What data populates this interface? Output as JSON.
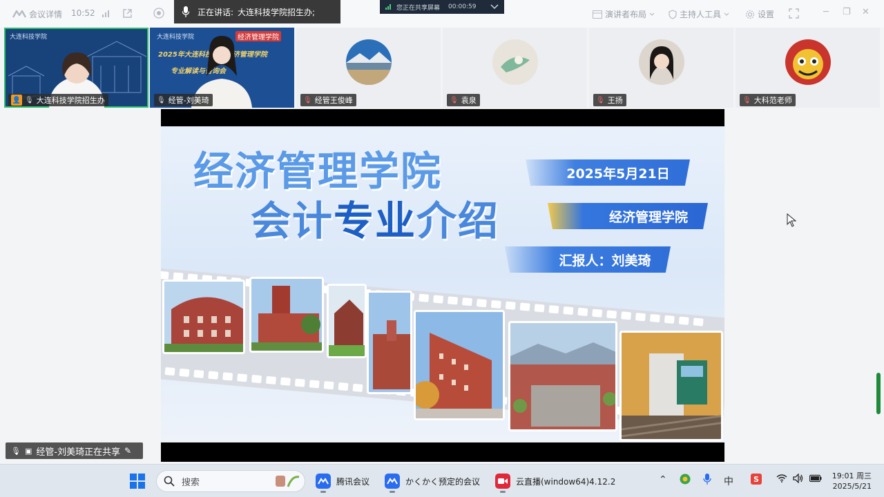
{
  "topbar": {
    "meeting_info_label": "会议详情",
    "time": "10:52",
    "speaking_label": "正在讲话:",
    "speaking_name": "大连科技学院招生办;",
    "share_status": "您正在共享屏幕",
    "share_timer": "00:00:59",
    "presenter_layout_label": "演讲者布局",
    "host_tools_label": "主持人工具",
    "settings_label": "设置"
  },
  "participants": [
    {
      "name": "大连科技学院招生办",
      "role": "host"
    },
    {
      "name": "经管-刘美琦"
    },
    {
      "name": "经管王俊峰"
    },
    {
      "name": "袁泉"
    },
    {
      "name": "王扬"
    },
    {
      "name": "大科范老师"
    }
  ],
  "tile_texts": {
    "college_logo_1": "大连科技学院",
    "college_logo_2": "大连科技学院",
    "dept_logo": "经济管理学院",
    "banner_line1": "2025年大连科技学院经济管理学院",
    "banner_line2": "专业解读与咨询会"
  },
  "slide": {
    "title_line1": "经济管理学院",
    "title_line2_a": "会计",
    "title_line2_b": "专业",
    "title_line2_c": "介绍",
    "date": "2025年5月21日",
    "school": "经济管理学院",
    "reporter": "汇报人：刘美琦"
  },
  "sharing_label": "经管-刘美琦正在共享",
  "taskbar": {
    "search_placeholder": "搜索",
    "apps": [
      {
        "label": "腾讯会议"
      },
      {
        "label": "かくかく预定的会议"
      },
      {
        "label": "云直播(window64)4.12.2"
      }
    ],
    "clock_time": "19:01 周三",
    "clock_date": "2025/5/21"
  },
  "colors": {
    "accent_green": "#2fc26b",
    "ribbon_blue": "#2f6ed8",
    "title_blue": "#4a88dc",
    "host_orange": "#f39a1e"
  }
}
